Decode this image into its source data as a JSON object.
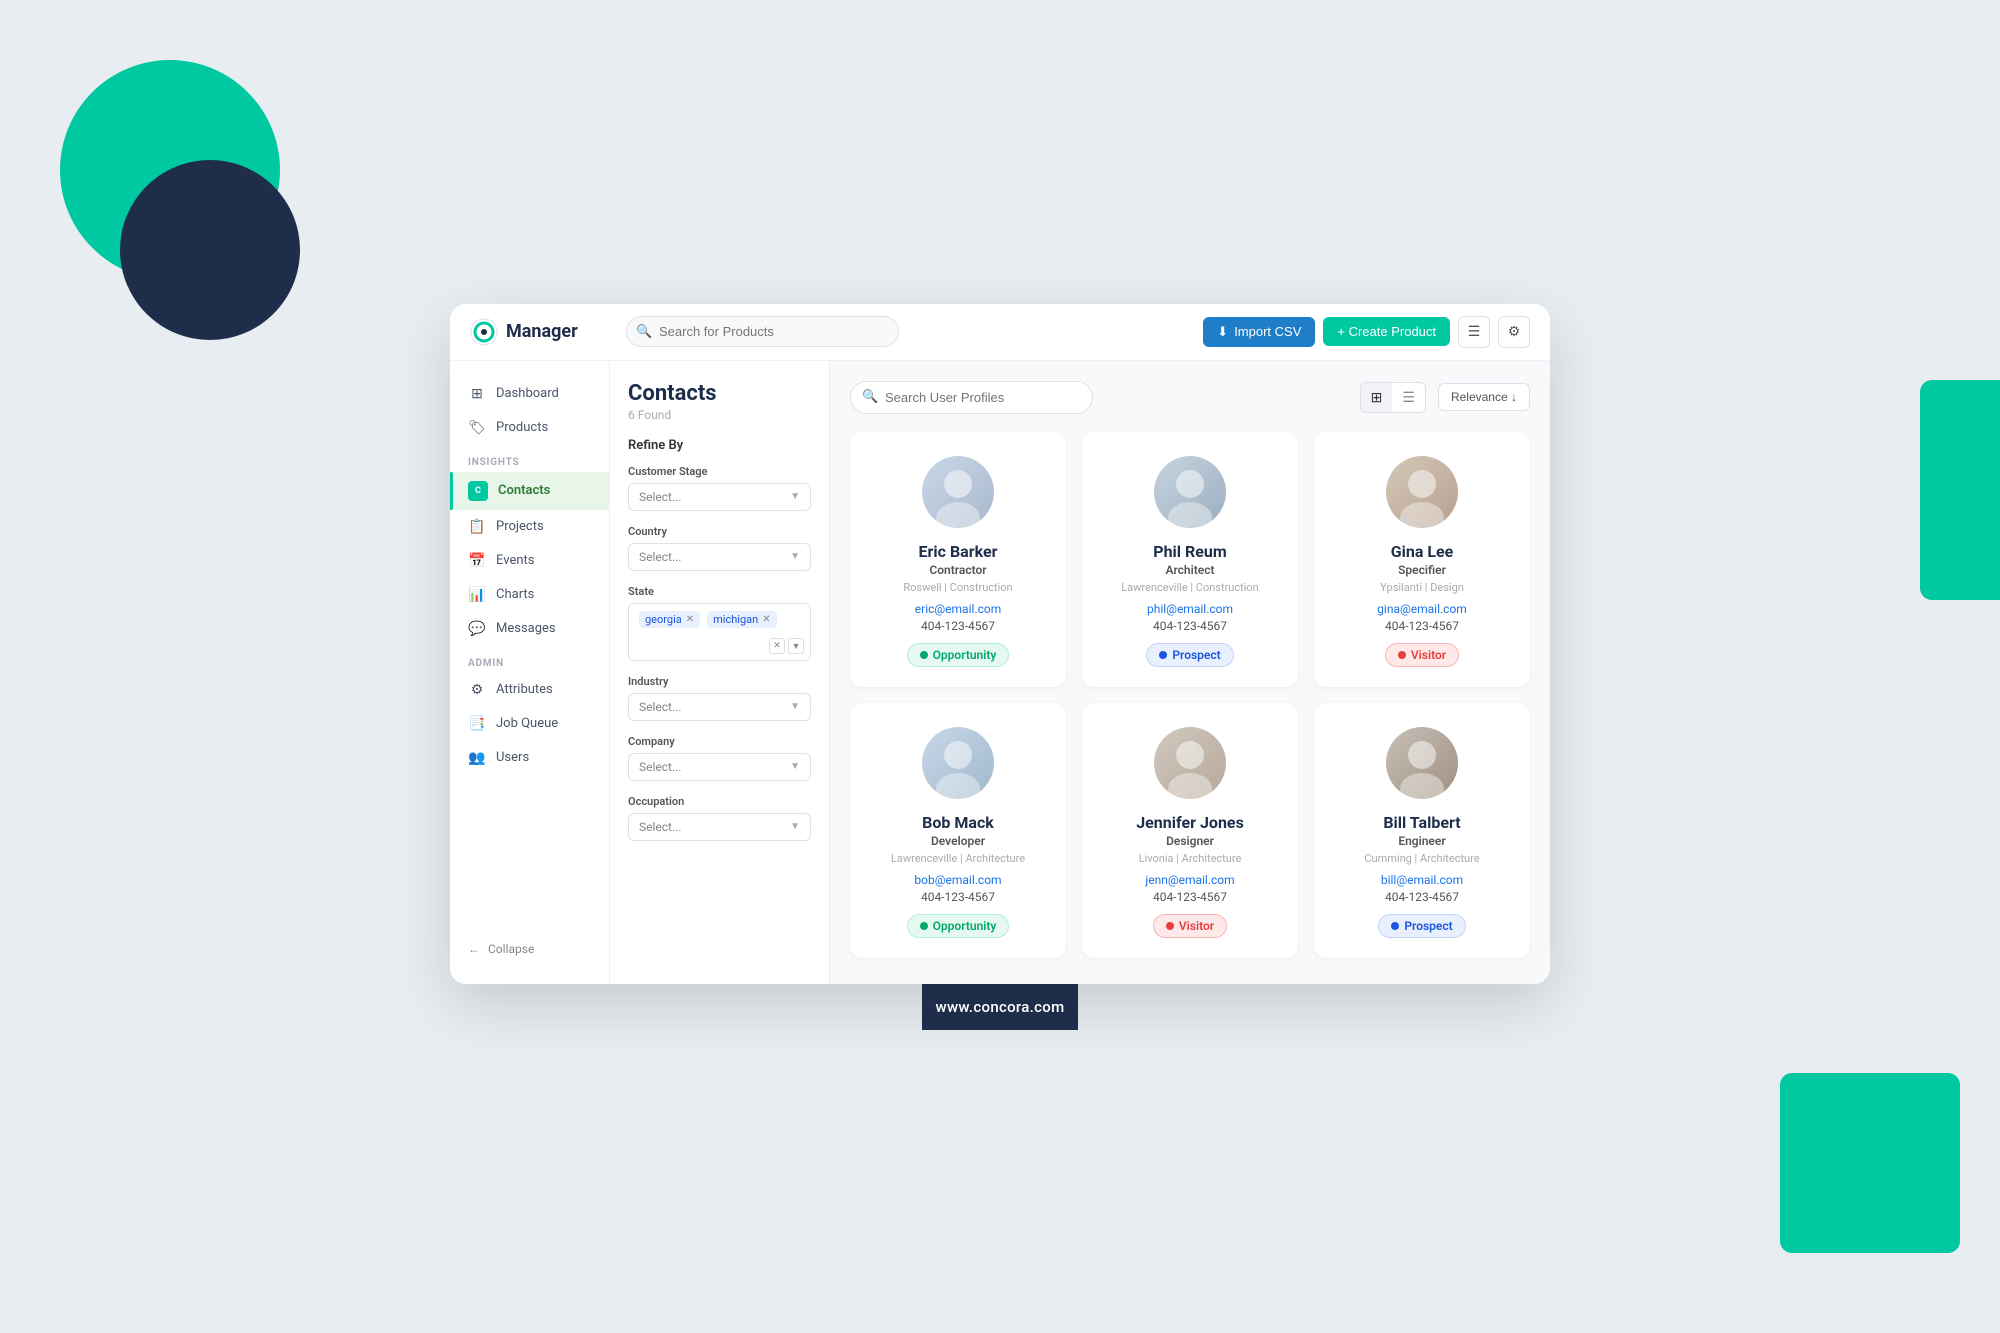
{
  "app": {
    "logo_text": "Manager",
    "search_placeholder": "Search for Products"
  },
  "topbar": {
    "import_label": "Import CSV",
    "create_label": "+ Create Product"
  },
  "sidebar": {
    "items": [
      {
        "label": "Dashboard",
        "icon": "⊞",
        "active": false
      },
      {
        "label": "Products",
        "icon": "🏷",
        "active": false
      },
      {
        "section": "INSIGHTS"
      },
      {
        "label": "Contacts",
        "icon": "👤",
        "active": true
      },
      {
        "label": "Projects",
        "icon": "📋",
        "active": false
      },
      {
        "label": "Events",
        "icon": "📅",
        "active": false
      },
      {
        "label": "Charts",
        "icon": "📊",
        "active": false
      },
      {
        "label": "Messages",
        "icon": "💬",
        "active": false
      },
      {
        "section": "ADMIN"
      },
      {
        "label": "Attributes",
        "icon": "⚙",
        "active": false
      },
      {
        "label": "Job Queue",
        "icon": "📑",
        "active": false
      },
      {
        "label": "Users",
        "icon": "👥",
        "active": false
      }
    ],
    "collapse_label": "Collapse"
  },
  "filters": {
    "title": "Contacts",
    "count": "6 Found",
    "refine_by": "Refine By",
    "groups": [
      {
        "label": "Customer Stage",
        "placeholder": "Select...",
        "type": "select"
      },
      {
        "label": "Country",
        "placeholder": "Select...",
        "type": "select"
      },
      {
        "label": "State",
        "type": "tags",
        "tags": [
          "georgia",
          "michigan"
        ]
      },
      {
        "label": "Industry",
        "placeholder": "Select...",
        "type": "select"
      },
      {
        "label": "Company",
        "placeholder": "Select...",
        "type": "select"
      },
      {
        "label": "Occupation",
        "placeholder": "Select...",
        "type": "select"
      }
    ]
  },
  "contacts_toolbar": {
    "search_placeholder": "Search User Profiles",
    "sort_label": "Relevance ↓"
  },
  "contacts": [
    {
      "name": "Eric Barker",
      "title": "Contractor",
      "location_city": "Roswell",
      "location_type": "Construction",
      "email": "eric@email.com",
      "phone": "404-123-4567",
      "badge": "Opportunity",
      "badge_type": "opportunity"
    },
    {
      "name": "Phil Reum",
      "title": "Architect",
      "location_city": "Lawrenceville",
      "location_type": "Construction",
      "email": "phil@email.com",
      "phone": "404-123-4567",
      "badge": "Prospect",
      "badge_type": "prospect"
    },
    {
      "name": "Gina Lee",
      "title": "Specifier",
      "location_city": "Ypsilanti",
      "location_type": "Design",
      "email": "gina@email.com",
      "phone": "404-123-4567",
      "badge": "Visitor",
      "badge_type": "visitor"
    },
    {
      "name": "Bob Mack",
      "title": "Developer",
      "location_city": "Lawrenceville",
      "location_type": "Architecture",
      "email": "bob@email.com",
      "phone": "404-123-4567",
      "badge": "Opportunity",
      "badge_type": "opportunity"
    },
    {
      "name": "Jennifer Jones",
      "title": "Designer",
      "location_city": "Livonia",
      "location_type": "Architecture",
      "email": "jenn@email.com",
      "phone": "404-123-4567",
      "badge": "Visitor",
      "badge_type": "visitor"
    },
    {
      "name": "Bill Talbert",
      "title": "Engineer",
      "location_city": "Cumming",
      "location_type": "Architecture",
      "email": "bill@email.com",
      "phone": "404-123-4567",
      "badge": "Prospect",
      "badge_type": "prospect"
    }
  ],
  "footer": {
    "url": "www.concora.com"
  }
}
